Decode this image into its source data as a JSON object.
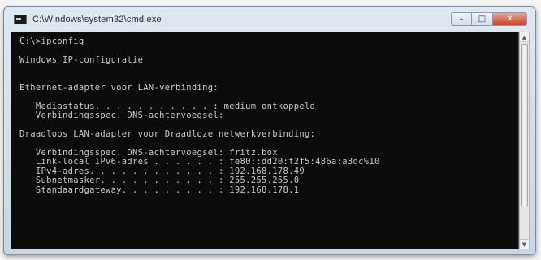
{
  "window": {
    "title": "C:\\Windows\\system32\\cmd.exe",
    "controls": {
      "minimize": "–",
      "maximize": "□",
      "close": "✕"
    }
  },
  "console": {
    "lines": [
      "C:\\>ipconfig",
      "",
      "Windows IP-configuratie",
      "",
      "",
      "Ethernet-adapter voor LAN-verbinding:",
      "",
      "   Mediastatus. . . . . . . . . . . : medium ontkoppeld",
      "   Verbindingsspec. DNS-achtervoegsel:",
      "",
      "Draadloos LAN-adapter voor Draadloze netwerkverbinding:",
      "",
      "   Verbindingsspec. DNS-achtervoegsel: fritz.box",
      "   Link-local IPv6-adres . . . . . . : fe80::dd20:f2f5:486a:a3dc%10",
      "   IPv4-adres. . . . . . . . . . . . : 192.168.178.49",
      "   Subnetmasker. . . . . . . . . . . : 255.255.255.0",
      "   Standaardgateway. . . . . . . . . : 192.168.178.1"
    ]
  }
}
